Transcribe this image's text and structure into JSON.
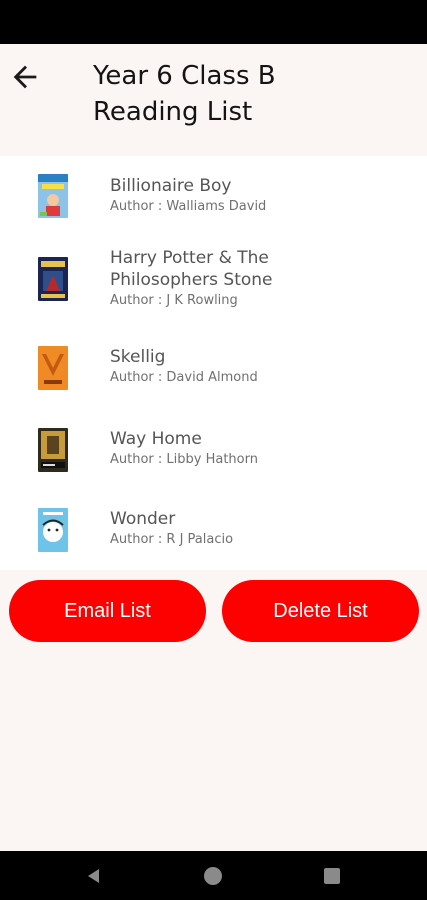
{
  "header": {
    "back_icon": "arrow-left-icon",
    "title_line1": "Year 6 Class B",
    "title_line2": "Reading List"
  },
  "books": [
    {
      "title": "Billionaire Boy",
      "author": "Author : Walliams David",
      "cover_color": "#7fb7e0"
    },
    {
      "title": "Harry Potter & The Philosophers Stone",
      "title_line1": "Harry Potter & The",
      "title_line2": "Philosophers Stone",
      "author": "Author : J K Rowling",
      "cover_color": "#1f2a5a"
    },
    {
      "title": "Skellig",
      "author": "Author : David Almond",
      "cover_color": "#f08a24"
    },
    {
      "title": "Way Home",
      "author": "Author : Libby Hathorn",
      "cover_color": "#3a3320"
    },
    {
      "title": "Wonder",
      "author": "Author : R J Palacio",
      "cover_color": "#6ec4e8"
    }
  ],
  "actions": {
    "email_label": "Email List",
    "delete_label": "Delete List"
  },
  "colors": {
    "accent": "#fd0100",
    "background": "#fbf6f3",
    "list_background": "#ffffff"
  },
  "navigation": {
    "back_icon": "triangle-back-icon",
    "home_icon": "circle-home-icon",
    "recents_icon": "square-recents-icon"
  }
}
